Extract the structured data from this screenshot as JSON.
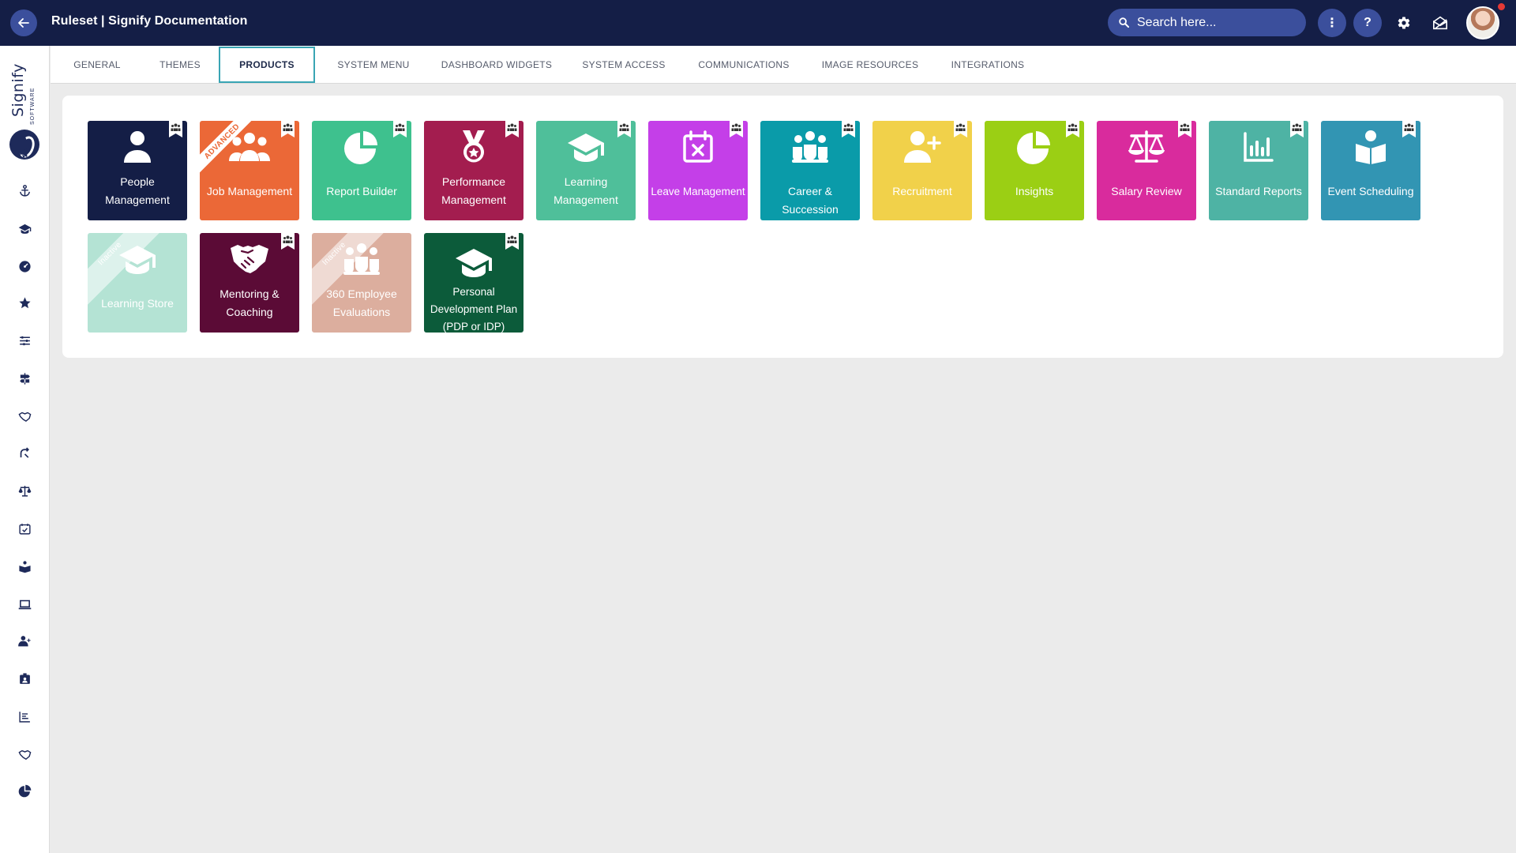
{
  "header": {
    "title": "Ruleset | Signify Documentation",
    "search_placeholder": "Search here...",
    "help_label": "?",
    "more_label": "⋮"
  },
  "logo": {
    "name": "Signify",
    "tagline": "SOFTWARE"
  },
  "tabs": [
    {
      "label": "GENERAL"
    },
    {
      "label": "THEMES"
    },
    {
      "label": "PRODUCTS",
      "active": true
    },
    {
      "label": "SYSTEM MENU"
    },
    {
      "label": "DASHBOARD WIDGETS"
    },
    {
      "label": "SYSTEM ACCESS"
    },
    {
      "label": "COMMUNICATIONS"
    },
    {
      "label": "IMAGE RESOURCES"
    },
    {
      "label": "INTEGRATIONS"
    }
  ],
  "products": [
    {
      "label": "People Management",
      "color": "#141e46",
      "icon": "person-icon"
    },
    {
      "label": "Job Management",
      "color": "#eb6837",
      "icon": "group-icon",
      "badge": "ADVANCED"
    },
    {
      "label": "Report Builder",
      "color": "#3ec18e",
      "icon": "pie-chart-icon"
    },
    {
      "label": "Performance Management",
      "color": "#a31d4f",
      "icon": "medal-icon"
    },
    {
      "label": "Learning Management",
      "color": "#4fbf9a",
      "icon": "graduation-cap-icon"
    },
    {
      "label": "Leave Management",
      "color": "#c43fe8",
      "icon": "calendar-x-icon"
    },
    {
      "label": "Career & Succession",
      "color": "#0a9ba9",
      "icon": "team-icon"
    },
    {
      "label": "Recruitment",
      "color": "#f1d14a",
      "icon": "person-add-icon"
    },
    {
      "label": "Insights",
      "color": "#9bcf14",
      "icon": "pie-chart-icon"
    },
    {
      "label": "Salary Review",
      "color": "#d92b9d",
      "icon": "scales-icon"
    },
    {
      "label": "Standard Reports",
      "color": "#4eb3a4",
      "icon": "bar-chart-icon"
    },
    {
      "label": "Event Scheduling",
      "color": "#3295b3",
      "icon": "book-reader-icon"
    },
    {
      "label": "Learning Store",
      "color": "#b4e3d4",
      "icon": "graduation-cap-icon",
      "badge": "Inactive"
    },
    {
      "label": "Mentoring & Coaching",
      "color": "#5b0b36",
      "icon": "handshake-icon"
    },
    {
      "label": "360 Employee Evaluations",
      "color": "#dcae9e",
      "icon": "team-icon",
      "badge": "Inactive"
    },
    {
      "label": "Personal Development Plan (PDP or IDP)",
      "color": "#0c5b3a",
      "icon": "graduation-cap-icon"
    }
  ],
  "sidebar_icons": [
    "megaphone-icon",
    "anchor-icon",
    "graduation-cap-icon",
    "gauge-icon",
    "star-icon",
    "sliders-icon",
    "signpost-icon",
    "handshake-icon",
    "route-icon",
    "scales-icon",
    "calendar-check-icon",
    "reader-icon",
    "laptop-icon",
    "person-add-icon",
    "badge-icon",
    "list-chart-icon",
    "handshake-icon",
    "pie-chart-icon"
  ]
}
